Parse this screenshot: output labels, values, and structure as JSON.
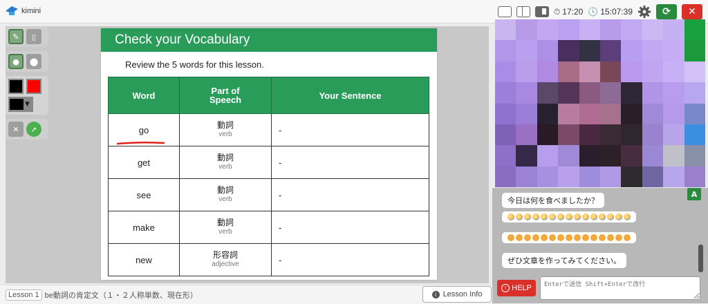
{
  "app": {
    "logo_text": "kimini"
  },
  "topbar": {
    "timer1": "17:20",
    "timer2": "15:07:39",
    "icons": [
      "layout-single-icon",
      "layout-split-icon",
      "layout-side-icon",
      "stopwatch-icon",
      "clock-icon",
      "gear-icon",
      "refresh-icon",
      "close-icon"
    ],
    "refresh_color": "#2a8a3e",
    "close_color": "#d9302a"
  },
  "toolbar": {
    "tools": [
      "pen-icon",
      "eraser-icon",
      "small-dot-icon",
      "large-dot-icon"
    ],
    "colors": [
      "#000000",
      "#ff0000"
    ],
    "selected_color": "#000000",
    "actions": [
      "clear-icon",
      "arrow-icon"
    ]
  },
  "lesson": {
    "title": "Check your Vocabulary",
    "intro": "Review the 5 words for this lesson.",
    "headers": {
      "word": "Word",
      "pos_line1": "Part of",
      "pos_line2": "Speech",
      "sentence": "Your Sentence"
    },
    "rows": [
      {
        "word": "go",
        "pos_jp": "動詞",
        "pos_en": "verb",
        "sentence": "-"
      },
      {
        "word": "get",
        "pos_jp": "動詞",
        "pos_en": "verb",
        "sentence": "-"
      },
      {
        "word": "see",
        "pos_jp": "動詞",
        "pos_en": "verb",
        "sentence": "-"
      },
      {
        "word": "make",
        "pos_jp": "動詞",
        "pos_en": "verb",
        "sentence": "-"
      },
      {
        "word": "new",
        "pos_jp": "形容詞",
        "pos_en": "adjective",
        "sentence": "-"
      }
    ],
    "accent_color": "#2a9c5a",
    "annotation_color": "#e0201a"
  },
  "bottom": {
    "lesson_badge": "Lesson 1",
    "lesson_name": "be動詞の肯定文（１・２人称単数、現在形）",
    "info_label": "Lesson Info"
  },
  "chat": {
    "font_toggle": "A",
    "messages": [
      {
        "type": "text",
        "text": "今日は何を食べましたか？"
      },
      {
        "type": "emoji",
        "icon": "blushing-face-icon",
        "count": 15
      },
      {
        "type": "emoji",
        "icon": "smiling-face-icon",
        "count": 15
      },
      {
        "type": "text",
        "text": "ぜひ文章を作ってみてください。"
      }
    ],
    "help_label": "HELP",
    "input_placeholder": "Enterで送信 Shift+Enterで改行"
  }
}
